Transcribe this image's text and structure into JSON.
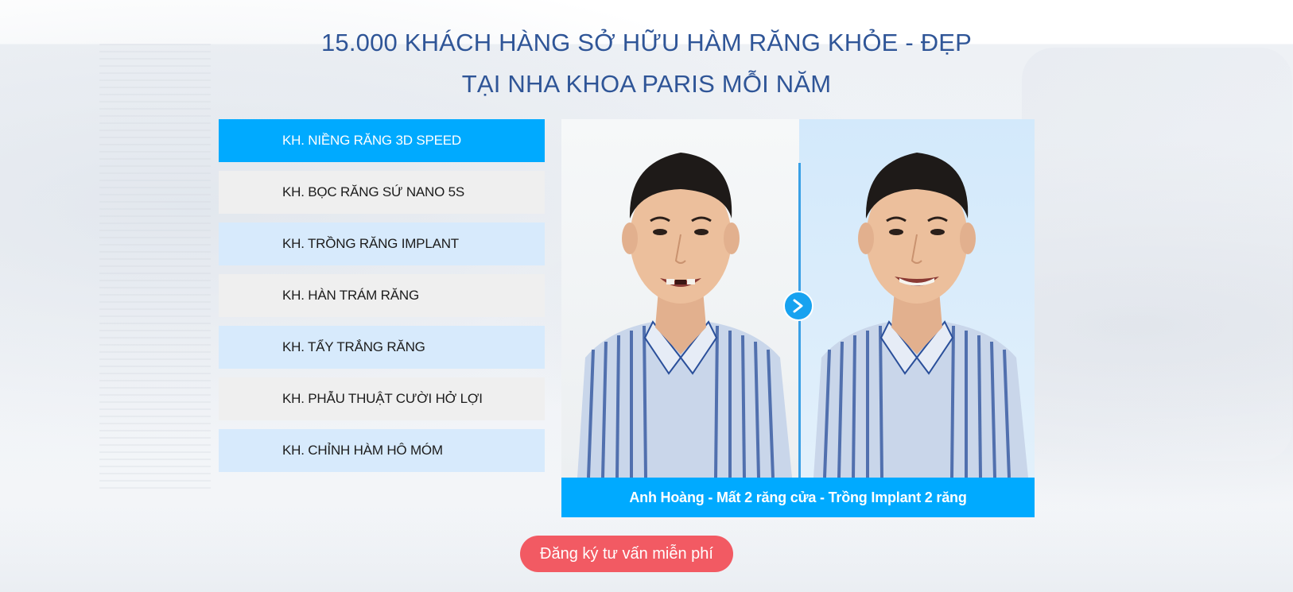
{
  "headline": {
    "line1": "15.000 KHÁCH HÀNG SỞ HỮU HÀM RĂNG KHỎE - ĐẸP",
    "line2": "TẠI NHA KHOA PARIS MỖI NĂM"
  },
  "tabs": [
    {
      "label": "KH. NIỀNG RĂNG 3D SPEED",
      "active": true
    },
    {
      "label": "KH. BỌC RĂNG SỨ NANO 5S",
      "active": false
    },
    {
      "label": "KH. TRỒNG RĂNG IMPLANT",
      "active": false
    },
    {
      "label": "KH. HÀN TRÁM RĂNG",
      "active": false
    },
    {
      "label": "KH. TẨY TRẮNG RĂNG",
      "active": false
    },
    {
      "label": "KH. PHẪU THUẬT CƯỜI HỞ LỢI",
      "active": false
    },
    {
      "label": "KH. CHỈNH HÀM HÔ MÓM",
      "active": false
    }
  ],
  "showcase": {
    "caption": "Anh Hoàng - Mất 2 răng cửa - Trồng Implant 2 răng",
    "next_icon": "chevron-right-icon"
  },
  "cta": {
    "label": "Đăng ký tư vấn miễn phí"
  },
  "colors": {
    "headline": "#2f5597",
    "accent": "#00aaff",
    "tab_light": "#d7eafc",
    "tab_gray": "#efefef",
    "cta": "#f25a63"
  }
}
